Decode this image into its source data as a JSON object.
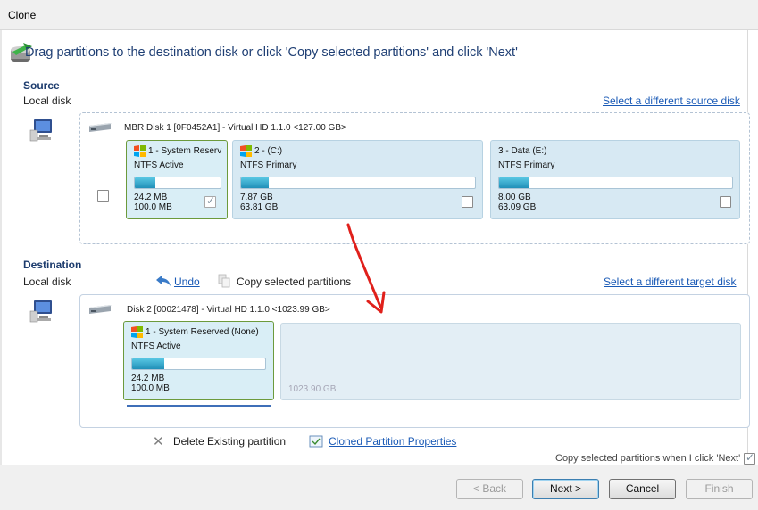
{
  "window": {
    "title": "Clone"
  },
  "instruction": "Drag partitions to the destination disk or click 'Copy selected partitions' and click 'Next'",
  "source": {
    "title": "Source",
    "subtitle": "Local disk",
    "change_link": "Select a different source disk",
    "disk": {
      "header": "MBR Disk 1 [0F0452A1] - Virtual HD 1.1.0  <127.00 GB>",
      "partitions": [
        {
          "label": "1 - System Reserv",
          "type": "NTFS Active",
          "used": "24.2 MB",
          "total": "100.0 MB",
          "fill_fraction": 0.24,
          "checked": true
        },
        {
          "label": "2 -  (C:)",
          "type": "NTFS Primary",
          "used": "7.87 GB",
          "total": "63.81 GB",
          "fill_fraction": 0.12,
          "checked": false
        },
        {
          "label": "3 - Data (E:)",
          "type": "NTFS Primary",
          "used": "8.00 GB",
          "total": "63.09 GB",
          "fill_fraction": 0.13,
          "checked": false
        }
      ]
    }
  },
  "destination": {
    "title": "Destination",
    "subtitle": "Local disk",
    "undo_label": "Undo",
    "copy_label": "Copy selected partitions",
    "change_link": "Select a different target disk",
    "disk": {
      "header": "Disk 2 [00021478] - Virtual HD 1.1.0  <1023.99 GB>",
      "partition": {
        "label": "1 - System Reserved (None)",
        "type": "NTFS Active",
        "used": "24.2 MB",
        "total": "100.0 MB",
        "fill_fraction": 0.24
      },
      "free_space": "1023.90 GB"
    }
  },
  "actions": {
    "delete_label": "Delete Existing partition",
    "properties_label": "Cloned Partition Properties",
    "copy_on_next_label": "Copy selected partitions when I click 'Next'"
  },
  "buttons": {
    "back": "< Back",
    "next": "Next >",
    "cancel": "Cancel",
    "finish": "Finish"
  },
  "colors": {
    "accent": "#1f3f74",
    "link": "#1a5ab6",
    "selected_border": "#6c9a3c",
    "arrow": "#e0201b"
  }
}
